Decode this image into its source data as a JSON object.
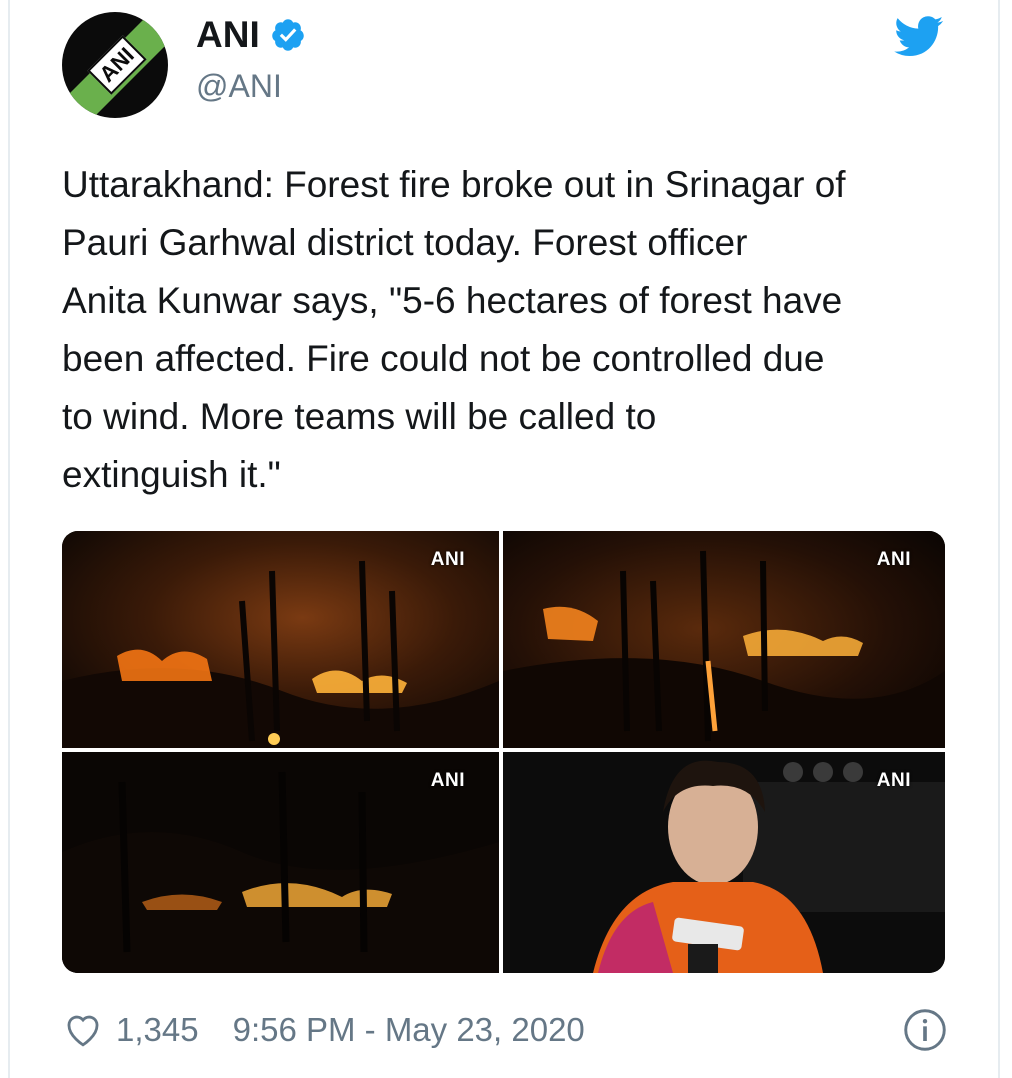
{
  "account": {
    "name": "ANI",
    "handle": "@ANI",
    "avatar_logo_text": "ANI"
  },
  "tweet": {
    "lines": [
      "Uttarakhand: Forest fire broke out in Srinagar of",
      "Pauri Garhwal district today. Forest officer",
      "Anita Kunwar says, \"5-6 hectares of forest have",
      "been affected. Fire could not be controlled due",
      "to wind. More teams will be called to",
      "extinguish it.\""
    ]
  },
  "media": {
    "watermarks": [
      "ANI",
      "ANI",
      "ANI",
      "ANI"
    ]
  },
  "footer": {
    "likes": "1,345",
    "timestamp": "9:56 PM - May 23, 2020"
  },
  "icons": {
    "verified": "verified-badge-icon",
    "brand": "twitter-bird-icon",
    "like": "heart-icon",
    "info": "info-icon"
  },
  "colors": {
    "twitter_blue": "#1da1f2",
    "secondary_text": "#657786",
    "primary_text": "#14171a",
    "fire": "#ff8a1f"
  }
}
